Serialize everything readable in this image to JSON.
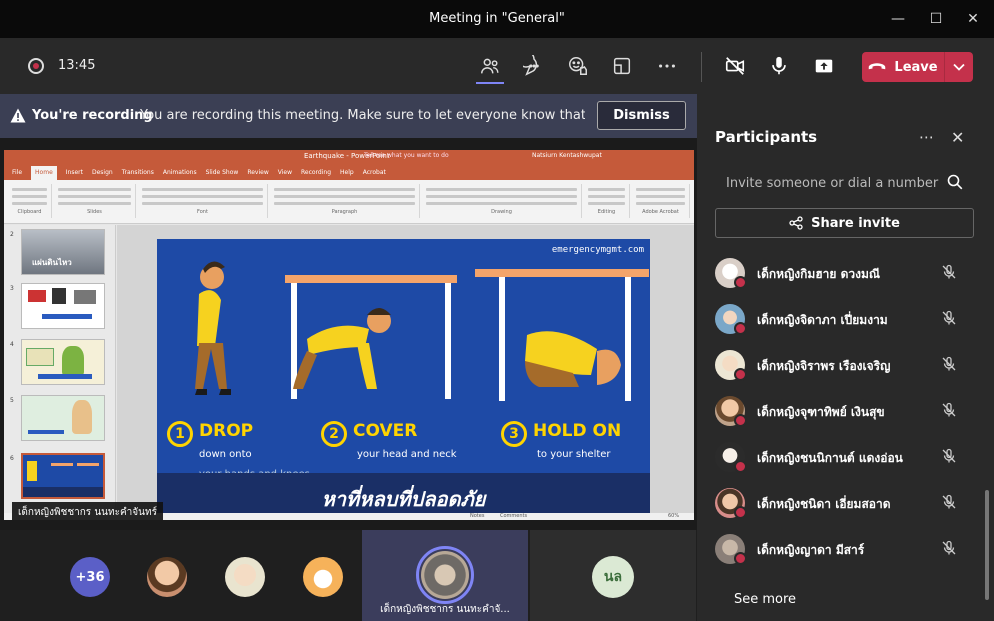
{
  "window": {
    "title": "Meeting in \"General\""
  },
  "toolbar": {
    "time": "13:45",
    "leave_label": "Leave",
    "colors": {
      "accent": "#7f85f5",
      "leave": "#c4314b"
    }
  },
  "banner": {
    "title": "You're recording",
    "message": "You are recording this meeting. Make sure to let everyone know that they a...",
    "dismiss_label": "Dismiss"
  },
  "presentation": {
    "file_name": "Earthquake - PowerPoint",
    "user_name": "Natsiurn Kentashwupat",
    "search_hint": "Tell me what you want to do",
    "tabs": [
      "File",
      "Home",
      "Insert",
      "Design",
      "Transitions",
      "Animations",
      "Slide Show",
      "Review",
      "View",
      "Recording",
      "Help",
      "Acrobat"
    ],
    "selected_tab": "Home",
    "ribbon_groups": [
      "Clipboard",
      "Slides",
      "Font",
      "Paragraph",
      "Drawing",
      "Editing",
      "Adobe Acrobat"
    ],
    "slide_numbers": [
      "2",
      "3",
      "4",
      "5",
      "6"
    ],
    "status_notes": "Notes",
    "status_comments": "Comments",
    "zoom": "60%",
    "slide": {
      "site": "emergencymgmt.com",
      "steps": [
        {
          "num": "1",
          "title": "DROP",
          "sub1": "down onto",
          "sub2": "your hands and knees"
        },
        {
          "num": "2",
          "title": "COVER",
          "sub1": "your head and neck",
          "sub2": ""
        },
        {
          "num": "3",
          "title": "HOLD ON",
          "sub1": "to your shelter",
          "sub2": ""
        }
      ],
      "caption": "หาที่หลบที่ปลอดภัย"
    },
    "thumb_captions": [
      "แผ่นดินไหว",
      "",
      "",
      "",
      ""
    ],
    "presenter_tag": "เด็กหญิงพิชชากร นนทะคำจันทร์"
  },
  "gallery": {
    "overflow_count": "+36",
    "active_name": "เด็กหญิงพิชชากร นนทะคำจั...",
    "initials": "นล"
  },
  "panel": {
    "title": "Participants",
    "invite_placeholder": "Invite someone or dial a number",
    "share_label": "Share invite",
    "participants": [
      {
        "name": "เด็กหญิงกิมฮาย ดวงมณี"
      },
      {
        "name": "เด็กหญิงจิดาภา เปี่ยมงาม"
      },
      {
        "name": "เด็กหญิงจิราพร เรืองเจริญ"
      },
      {
        "name": "เด็กหญิงจุฑาทิพย์ เงินสุข"
      },
      {
        "name": "เด็กหญิงชนนิกานต์ แดงอ่อน"
      },
      {
        "name": "เด็กหญิงชนิดา เอี่ยมสอาด"
      },
      {
        "name": "เด็กหญิงญาดา มีสาร์"
      }
    ],
    "see_more": "See more"
  }
}
